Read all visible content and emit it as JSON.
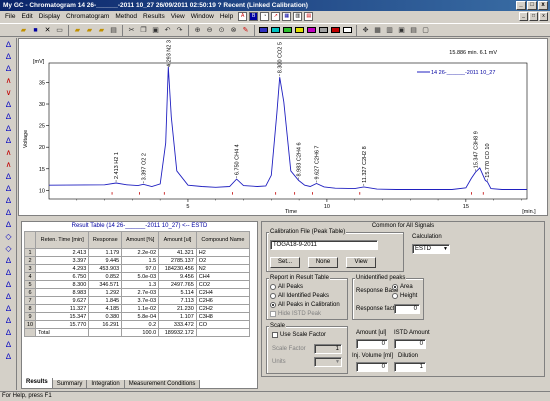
{
  "window": {
    "title": "My GC - Chromatogram 14     26-______-2011     10_27 26/09/2011 02:50:19 ? Recent (Linked Calibration)",
    "controls": [
      "_",
      "□",
      "x"
    ]
  },
  "menu": {
    "items": [
      "File",
      "Edit",
      "Display",
      "Chromatogram",
      "Method",
      "Results",
      "View",
      "Window",
      "Help"
    ],
    "right_controls": [
      "_",
      "□",
      "x"
    ]
  },
  "chart": {
    "header_right": "15.886 min.  6.1 mV",
    "y_unit": "[mV]",
    "y_label": "Voltage",
    "x_label": "Time",
    "x_unit": "[min.]",
    "legend_text": "14     26-______-2011     10_27",
    "peak_labels": [
      "2.413 H2 1",
      "3.397 O2 2",
      "4.293 N2 3",
      "6.750 CH4 4",
      "8.300 CO2 5",
      "8.983 C2H4 6",
      "9.627 C2H6 7",
      "11.327 C2H2 8",
      "15.347 C3H8 9",
      "15.770 CO 10"
    ]
  },
  "chart_data": {
    "type": "line",
    "xlabel": "Time",
    "ylabel": "Voltage",
    "x_unit": "[min.]",
    "y_unit": "[mV]",
    "xlim": [
      0,
      17.2
    ],
    "ylim": [
      8.0,
      39.5
    ],
    "xticks": [
      5,
      10,
      15
    ],
    "yticks": [
      10,
      15,
      20,
      25,
      30,
      35
    ],
    "series": [
      {
        "name": "14     26-______-2011     10_27",
        "x": [
          0,
          2.0,
          2.413,
          2.8,
          3.2,
          3.397,
          3.7,
          4.0,
          4.2,
          4.293,
          4.4,
          4.6,
          5.0,
          5.5,
          6.0,
          6.5,
          6.75,
          7.0,
          7.5,
          7.8,
          8.0,
          8.2,
          8.3,
          8.45,
          8.7,
          8.983,
          9.2,
          9.4,
          9.627,
          9.9,
          10.3,
          11.0,
          11.327,
          11.8,
          12.5,
          13.5,
          14.5,
          15.0,
          15.2,
          15.347,
          15.5,
          15.7,
          15.77,
          15.9,
          16.3,
          17.2
        ],
        "y": [
          11.2,
          11.3,
          11.7,
          11.3,
          11.1,
          11.4,
          10.9,
          11.5,
          21.0,
          38.6,
          27.0,
          14.5,
          11.2,
          10.9,
          10.7,
          10.9,
          12.6,
          11.1,
          10.9,
          11.0,
          13.5,
          28.0,
          36.2,
          30.5,
          14.5,
          12.3,
          11.2,
          10.9,
          11.6,
          10.8,
          10.5,
          10.4,
          10.8,
          10.3,
          10.2,
          10.2,
          10.2,
          10.6,
          12.8,
          14.2,
          15.2,
          12.3,
          12.0,
          10.4,
          10.2,
          10.2
        ]
      }
    ],
    "legend": "top-right",
    "grid": false
  },
  "results": {
    "title": "Result Table (14     26-______-2011     10_27) <-- ESTD",
    "columns": [
      "",
      "Reten. Time [min]",
      "Response",
      "Amount [%]",
      "Amount [ul]",
      "Compound Name"
    ],
    "rows": [
      [
        "1",
        "2.413",
        "1.179",
        "2.2e-02",
        "41.321",
        "H2"
      ],
      [
        "2",
        "3.397",
        "9.445",
        "1.5",
        "2785.137",
        "O2"
      ],
      [
        "3",
        "4.293",
        "453.903",
        "97.0",
        "184230.456",
        "N2"
      ],
      [
        "4",
        "6.750",
        "0.852",
        "5.0e-03",
        "9.456",
        "CH4"
      ],
      [
        "5",
        "8.300",
        "346.571",
        "1.3",
        "2497.765",
        "CO2"
      ],
      [
        "6",
        "8.983",
        "1.292",
        "2.7e-03",
        "5.114",
        "C2H4"
      ],
      [
        "7",
        "9.627",
        "1.845",
        "3.7e-03",
        "7.113",
        "C2H6"
      ],
      [
        "8",
        "11.327",
        "4.185",
        "1.1e-02",
        "21.230",
        "C2H2"
      ],
      [
        "9",
        "15.347",
        "0.380",
        "5.8e-04",
        "1.107",
        "C3H8"
      ],
      [
        "10",
        "15.770",
        "16.291",
        "0.2",
        "333.472",
        "CO"
      ]
    ],
    "total": [
      "",
      "Total",
      "",
      "100.0",
      "189932.172",
      ""
    ]
  },
  "tabs": [
    "Results",
    "Summary",
    "Integration",
    "Measurement Conditions"
  ],
  "signals": {
    "title": "Common for All Signals",
    "calib_label": "Calibration File (Peak Table)",
    "calib_file": "TOGA18-9-2011",
    "btn_set": "Set...",
    "btn_none": "None",
    "btn_view": "View",
    "calc_label": "Calculation",
    "calc_value": "ESTD",
    "report_label": "Report in Result Table",
    "report_opts": [
      "All Peaks",
      "All Identified Peaks",
      "All Peaks in Calibration",
      "Hide ISTD Peak"
    ],
    "unid_label": "Unidentified peaks",
    "resp_base_label": "Response Base",
    "resp_opts": [
      "Area",
      "Height"
    ],
    "resp_fact_label": "Response fact.",
    "resp_fact_value": "0",
    "scale_label": "Scale",
    "use_scale_label": "Use Scale Factor",
    "scale_factor_label": "Scale Factor",
    "scale_factor_value": "1",
    "units_label": "Units",
    "amount_label": "Amount [ul]",
    "istd_label": "ISTD Amount",
    "amount_value": "0",
    "istd_value": "0",
    "inj_label": "Inj. Volume [ml]",
    "inj_value": "0",
    "dil_label": "Dilution",
    "dil_value": "1"
  },
  "status": "For Help, press F1"
}
